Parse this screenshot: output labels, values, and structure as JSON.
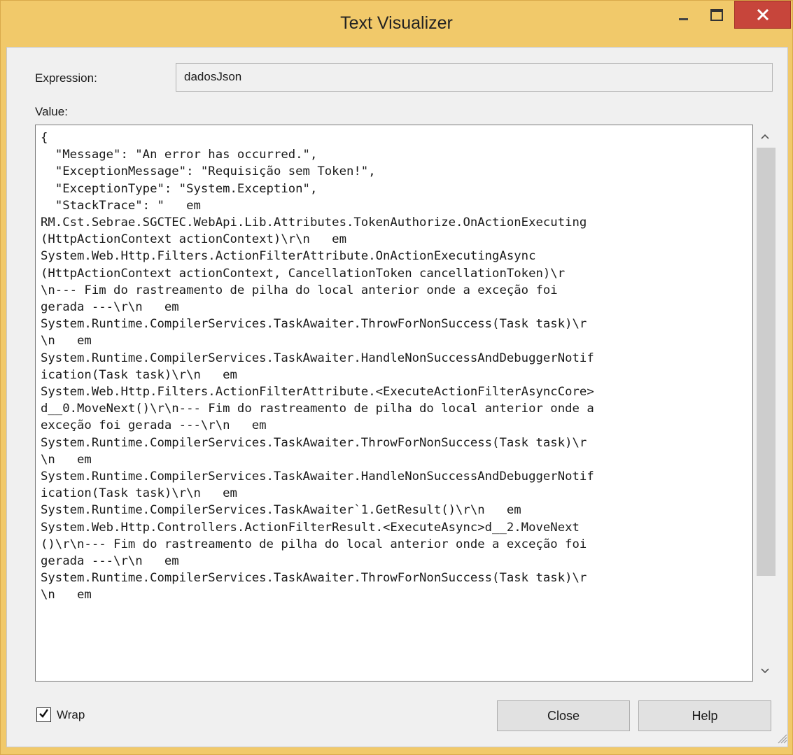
{
  "window": {
    "title": "Text Visualizer",
    "controls": {
      "minimize": "minimize-icon",
      "maximize": "maximize-icon",
      "close": "close-icon"
    },
    "colors": {
      "frame": "#f1c96a",
      "close_button": "#c7453b",
      "client": "#f0f0f0"
    }
  },
  "expression": {
    "label": "Expression:",
    "value": "dadosJson"
  },
  "value": {
    "label": "Value:",
    "text": "{\n  \"Message\": \"An error has occurred.\",\n  \"ExceptionMessage\": \"Requisição sem Token!\",\n  \"ExceptionType\": \"System.Exception\",\n  \"StackTrace\": \"   em\nRM.Cst.Sebrae.SGCTEC.WebApi.Lib.Attributes.TokenAuthorize.OnActionExecuting\n(HttpActionContext actionContext)\\r\\n   em\nSystem.Web.Http.Filters.ActionFilterAttribute.OnActionExecutingAsync\n(HttpActionContext actionContext, CancellationToken cancellationToken)\\r\n\\n--- Fim do rastreamento de pilha do local anterior onde a exceção foi\ngerada ---\\r\\n   em\nSystem.Runtime.CompilerServices.TaskAwaiter.ThrowForNonSuccess(Task task)\\r\n\\n   em\nSystem.Runtime.CompilerServices.TaskAwaiter.HandleNonSuccessAndDebuggerNotif\nication(Task task)\\r\\n   em\nSystem.Web.Http.Filters.ActionFilterAttribute.<ExecuteActionFilterAsyncCore>\nd__0.MoveNext()\\r\\n--- Fim do rastreamento de pilha do local anterior onde a\nexceção foi gerada ---\\r\\n   em\nSystem.Runtime.CompilerServices.TaskAwaiter.ThrowForNonSuccess(Task task)\\r\n\\n   em\nSystem.Runtime.CompilerServices.TaskAwaiter.HandleNonSuccessAndDebuggerNotif\nication(Task task)\\r\\n   em\nSystem.Runtime.CompilerServices.TaskAwaiter`1.GetResult()\\r\\n   em\nSystem.Web.Http.Controllers.ActionFilterResult.<ExecuteAsync>d__2.MoveNext\n()\\r\\n--- Fim do rastreamento de pilha do local anterior onde a exceção foi\ngerada ---\\r\\n   em\nSystem.Runtime.CompilerServices.TaskAwaiter.ThrowForNonSuccess(Task task)\\r\n\\n   em"
  },
  "scrollbar": {
    "up_icon": "chevron-up-icon",
    "down_icon": "chevron-down-icon"
  },
  "wrap": {
    "label": "Wrap",
    "checked": true
  },
  "buttons": {
    "close": "Close",
    "help": "Help"
  }
}
